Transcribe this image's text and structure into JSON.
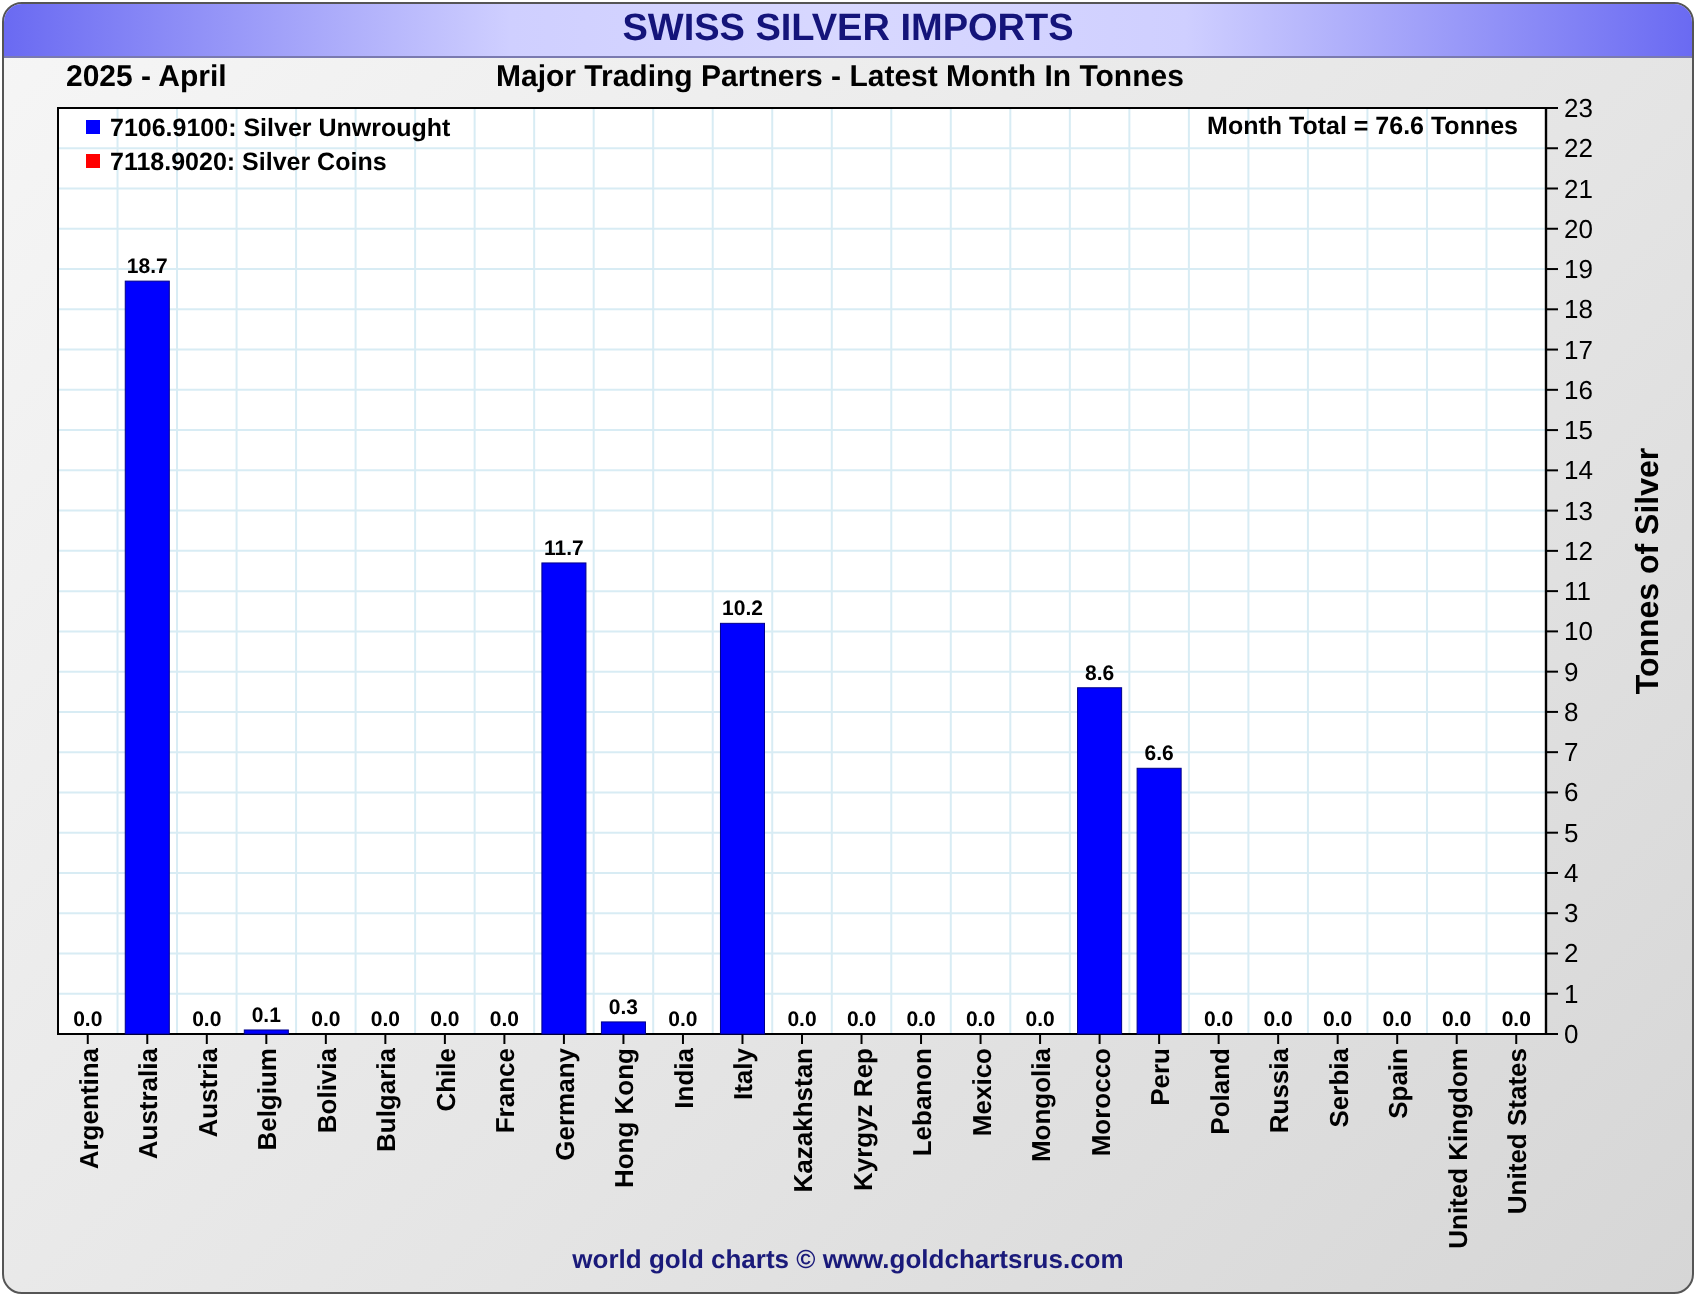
{
  "title": "SWISS SILVER IMPORTS",
  "period": "2025 - April",
  "chart_data": {
    "type": "bar",
    "title": "Major Trading Partners - Latest Month In Tonnes",
    "ylabel": "Tonnes of Silver",
    "grid": true,
    "categories": [
      "Argentina",
      "Australia",
      "Austria",
      "Belgium",
      "Bolivia",
      "Bulgaria",
      "Chile",
      "France",
      "Germany",
      "Hong Kong",
      "India",
      "Italy",
      "Kazakhstan",
      "Kyrgyz Rep",
      "Lebanon",
      "Mexico",
      "Mongolia",
      "Morocco",
      "Peru",
      "Poland",
      "Russia",
      "Serbia",
      "Spain",
      "United Kingdom",
      "United States"
    ],
    "series": [
      {
        "name": "7106.9100: Silver Unwrought",
        "color": "#0000ff",
        "values": [
          0,
          18.7,
          0,
          0.1,
          0,
          0,
          0,
          0,
          11.7,
          0.3,
          0,
          10.2,
          0,
          0,
          0,
          0,
          0,
          8.6,
          6.6,
          0,
          0,
          0,
          0,
          0,
          0
        ],
        "value_labels": [
          "0.0",
          "18.7",
          "0.0",
          "0.1",
          "0.0",
          "0.0",
          "0.0",
          "0.0",
          "11.7",
          "0.3",
          "0.0",
          "10.2",
          "0.0",
          "0.0",
          "0.0",
          "0.0",
          "0.0",
          "8.6",
          "6.6",
          "0.0",
          "0.0",
          "0.0",
          "0.0",
          "0.0",
          "0.0"
        ]
      },
      {
        "name": "7118.9020: Silver Coins",
        "color": "#ff0000",
        "values": [
          0,
          0,
          0,
          0,
          0,
          0,
          0,
          0,
          0,
          0,
          0,
          0,
          0,
          0,
          0,
          0,
          0,
          0,
          0,
          0,
          0,
          0,
          0,
          0,
          0
        ]
      }
    ],
    "ylim": [
      0,
      23
    ],
    "yticks": [
      0,
      1,
      2,
      3,
      4,
      5,
      6,
      7,
      8,
      9,
      10,
      11,
      12,
      13,
      14,
      15,
      16,
      17,
      18,
      19,
      20,
      21,
      22,
      23
    ],
    "annotations": [
      "Month Total = 76.6 Tonnes"
    ]
  },
  "footer": "world gold charts © www.goldchartsrus.com"
}
